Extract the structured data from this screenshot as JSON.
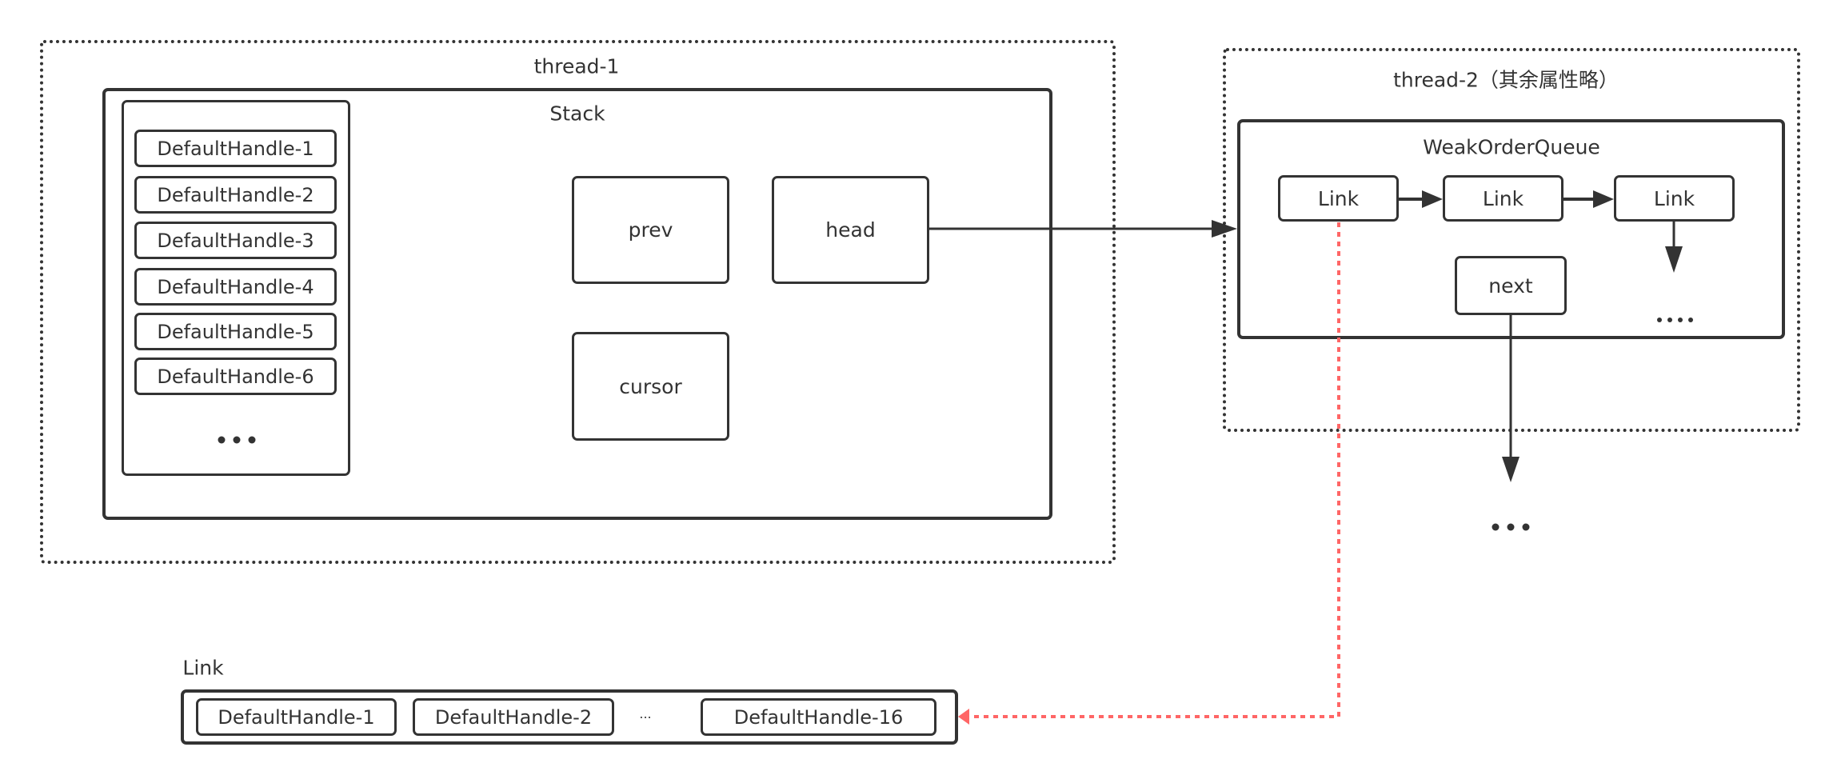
{
  "thread1": {
    "label": "thread-1",
    "stack": {
      "label": "Stack",
      "handles": [
        "DefaultHandle-1",
        "DefaultHandle-2",
        "DefaultHandle-3",
        "DefaultHandle-4",
        "DefaultHandle-5",
        "DefaultHandle-6"
      ],
      "handles_more": "•••",
      "fields": {
        "prev": "prev",
        "head": "head",
        "cursor": "cursor"
      }
    }
  },
  "thread2": {
    "label": "thread-2（其余属性略）",
    "weak_order_queue": {
      "label": "WeakOrderQueue",
      "links": [
        "Link",
        "Link",
        "Link"
      ],
      "next": "next",
      "links_more": "....",
      "next_more": "..."
    }
  },
  "link_detail": {
    "label": "Link",
    "handles": [
      "DefaultHandle-1",
      "DefaultHandle-2",
      "DefaultHandle-16"
    ],
    "ellipsis": "..."
  },
  "connectors": [
    {
      "from": "head",
      "to": "WeakOrderQueue",
      "style": "solid"
    },
    {
      "from": "Link-1",
      "to": "Link-2",
      "style": "solid"
    },
    {
      "from": "Link-2",
      "to": "Link-3",
      "style": "solid"
    },
    {
      "from": "Link-3",
      "to": "more-links",
      "style": "solid"
    },
    {
      "from": "next",
      "to": "next-queue",
      "style": "solid"
    },
    {
      "from": "Link-1",
      "to": "link-detail",
      "style": "dotted",
      "color": "#ff6666"
    }
  ],
  "colors": {
    "stroke": "#333333",
    "highlight": "#ff6666"
  }
}
